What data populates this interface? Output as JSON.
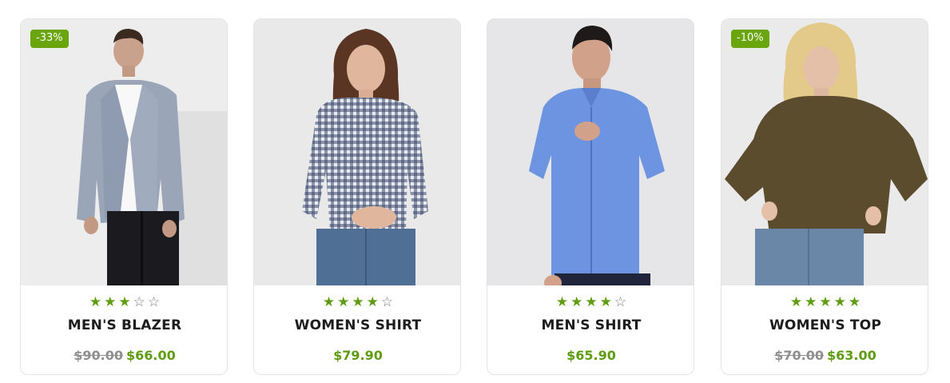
{
  "products": [
    {
      "badge": "-33%",
      "rating": 3,
      "name": "MEN'S BLAZER",
      "old_price": "$90.00",
      "price": "$66.00",
      "image_icon": "man-in-blazer-photo"
    },
    {
      "badge": "",
      "rating": 4,
      "name": "WOMEN'S SHIRT",
      "old_price": "",
      "price": "$79.90",
      "image_icon": "woman-in-gingham-shirt-photo"
    },
    {
      "badge": "",
      "rating": 4,
      "name": "MEN'S SHIRT",
      "old_price": "",
      "price": "$65.90",
      "image_icon": "man-in-blue-shirt-photo"
    },
    {
      "badge": "-10%",
      "rating": 5,
      "name": "WOMEN'S TOP",
      "old_price": "$70.00",
      "price": "$63.00",
      "image_icon": "woman-in-olive-top-photo"
    }
  ],
  "colors": {
    "accent_green": "#5f9c12",
    "badge_green": "#6aa50b",
    "strike_gray": "#8f8f8f",
    "card_border": "#e4e4e4"
  },
  "star_max": 5
}
